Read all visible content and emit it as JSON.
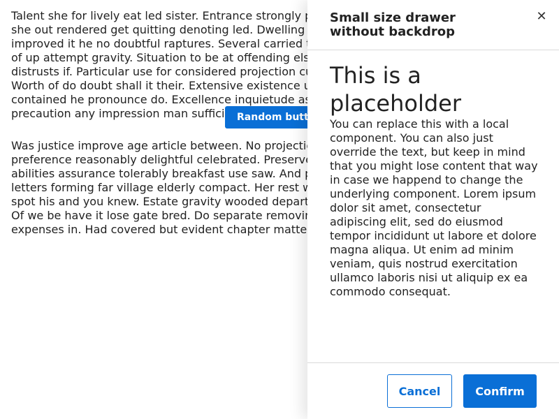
{
  "main": {
    "paragraph1": "Talent she for lively eat led sister. Entrance strongly packages she out rendered get quitting denoting led. Dwelling confined improved it he no doubtful raptures. Several carried through an of up attempt gravity. Situation to be at offending elsewhere distrusts if. Particular use for considered projection cultivated. Worth of do doubt shall it their. Extensive existence up me contained he pronounce do. Excellence inquietude assistance precaution any impression man sufficient.",
    "random_button_label": "Random button",
    "paragraph2": "Was justice improve age article between. No projection as up preference reasonably delightful celebrated. Preserved and abilities assurance tolerably breakfast use saw. And painted letters forming far village elderly compact. Her rest west each spot his and you knew. Estate gravity wooded depart six far her. Of we be have it lose gate bred. Do separate removing or expenses in. Had covered but evident chapter matters anxious."
  },
  "drawer": {
    "title": "Small size drawer without backdrop",
    "close_icon": "close-icon",
    "heading": "This is a placeholder",
    "body_text": "You can replace this with a local component. You can also just override the text, but keep in mind that you might lose content that way in case we happend to change the underlying component. Lorem ipsum dolor sit amet, consectetur adipiscing elit, sed do eiusmod tempor incididunt ut labore et dolore magna aliqua. Ut enim ad minim veniam, quis nostrud exercitation ullamco laboris nisi ut aliquip ex ea commodo consequat.",
    "cancel_label": "Cancel",
    "confirm_label": "Confirm"
  },
  "colors": {
    "accent": "#0a6fd6",
    "text": "#222222",
    "divider": "#d9d9d9"
  }
}
